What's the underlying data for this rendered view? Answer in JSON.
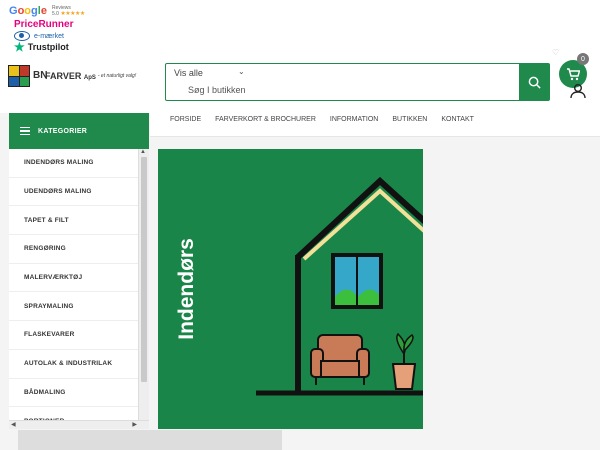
{
  "trust": {
    "google": "Google",
    "google_meta": "Reviews",
    "google_rating": "5.0",
    "google_stars": "★★★★★",
    "pricerunner": "PriceRunner",
    "emaerket": "e-mærket",
    "trustpilot": "Trustpilot"
  },
  "header": {
    "logo_bn": "BN",
    "logo_name": "FARVER",
    "logo_aps": "ApS",
    "logo_tagline": "- et naturligt valg!",
    "search_category": "Vis alle",
    "search_placeholder": "Søg I butikken",
    "cart_count": "0"
  },
  "nav": {
    "categories_label": "KATEGORIER",
    "menu": [
      "FORSIDE",
      "FARVERKORT & BROCHURER",
      "INFORMATION",
      "BUTIKKEN",
      "KONTAKT"
    ]
  },
  "categories": [
    "INDENDØRS MALING",
    "UDENDØRS MALING",
    "TAPET & FILT",
    "RENGØRING",
    "MALERVÆRKTØJ",
    "SPRAYMALING",
    "FLASKEVARER",
    "AUTOLAK & INDUSTRILAK",
    "BÅDMALING",
    "PORTIONER"
  ],
  "hero": {
    "title": "Indendørs"
  },
  "colors": {
    "brand_green": "#1f8a4c",
    "hero_green": "#1a8548"
  }
}
